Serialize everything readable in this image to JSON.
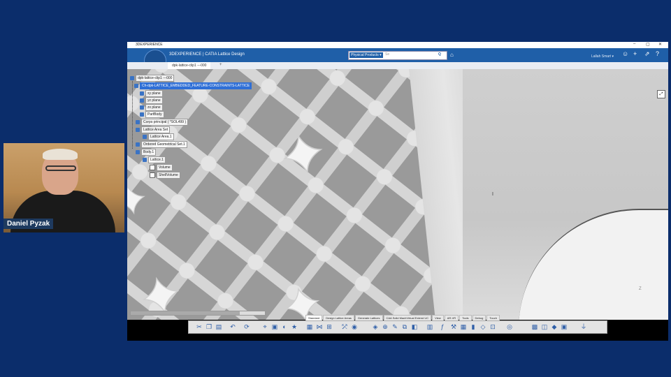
{
  "presenter": {
    "name": "Daniel Pyzak"
  },
  "window": {
    "title": "3DEXPERIENCE",
    "controls": [
      "–",
      "▢",
      "✕"
    ]
  },
  "appbar": {
    "brand": "3DEXPERIENCE | CATIA Lattice Design",
    "search_scope": "Physical Products ▾",
    "search_placeholder": "Se",
    "search_button": "Q",
    "user": "Lallah Smart ▾"
  },
  "tab": {
    "label": "dpk-lattice-clip1 ---000",
    "plus": "+"
  },
  "tree": {
    "root": "dpk-lattice-clip1 ---000",
    "selected": "Ch-dpk-LATTICE_EMBEDDED_FEATURE-CONSTRAINTS-LATTICE",
    "items": [
      "xy plane",
      "yz plane",
      "zx plane",
      "PartBody",
      "Corps principal ( *SOL499 )",
      "Lattice Area Set",
      "Lattice Area.1",
      "Ordered Geometrical Set.1",
      "Body.1",
      "Lattice.1",
      "Volume",
      "ShellVolume"
    ]
  },
  "action_tabs": [
    "Standard",
    "Design Lattice Areas",
    "Generate Lattices",
    "CAA Solid MachVirtual Extend UC",
    "View",
    "AR-VR",
    "Tools",
    "Debug",
    "Touch"
  ],
  "active_action_tab": "Standard",
  "viewport": {
    "axis_label": "Z",
    "cursor": "I"
  },
  "icons": {
    "app": "compass-logo-icon",
    "tag": "tag-icon",
    "share": "share-icon",
    "add": "plus-icon",
    "help": "help-icon",
    "user": "user-icon"
  }
}
